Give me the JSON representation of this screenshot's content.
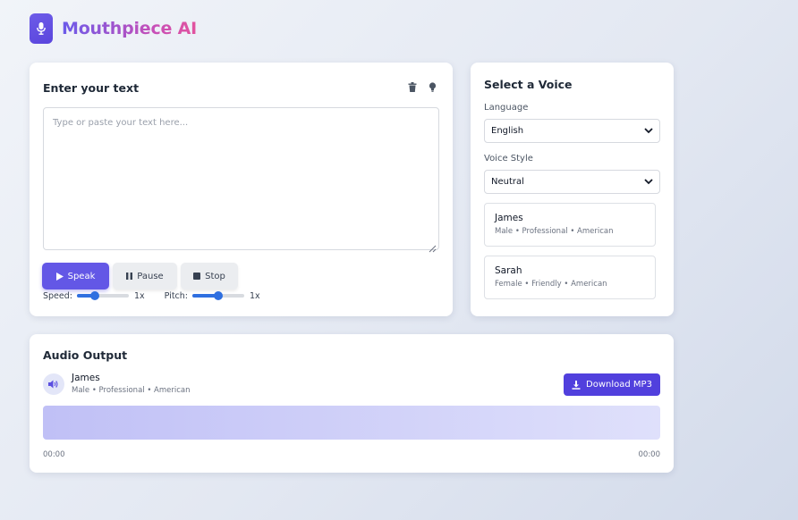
{
  "app": {
    "title": "Mouthpiece AI",
    "logo_icon": "microphone-icon"
  },
  "text_panel": {
    "title": "Enter your text",
    "placeholder": "Type or paste your text here...",
    "value": "",
    "icons": [
      "trash-icon",
      "lightbulb-icon"
    ],
    "buttons": {
      "speak": "Speak",
      "pause": "Pause",
      "stop": "Stop"
    },
    "speed": {
      "label": "Speed:",
      "value": "1x",
      "level": 0.35
    },
    "pitch": {
      "label": "Pitch:",
      "value": "1x",
      "level": 0.5
    }
  },
  "voice_panel": {
    "title": "Select a Voice",
    "language_label": "Language",
    "language_value": "English",
    "style_label": "Voice Style",
    "style_value": "Neutral",
    "voices": [
      {
        "name": "James",
        "desc": "Male • Professional • American"
      },
      {
        "name": "Sarah",
        "desc": "Female • Friendly • American"
      }
    ]
  },
  "audio_panel": {
    "title": "Audio Output",
    "voice_name": "James",
    "voice_desc": "Male • Professional • American",
    "download_label": "Download MP3",
    "time_start": "00:00",
    "time_end": "00:00"
  },
  "colors": {
    "accent": "#6357e6",
    "download": "#5140dd",
    "slider": "#2f6fe0",
    "waveform_start": "#c0c0f6",
    "waveform_end": "#dfe0fb"
  }
}
